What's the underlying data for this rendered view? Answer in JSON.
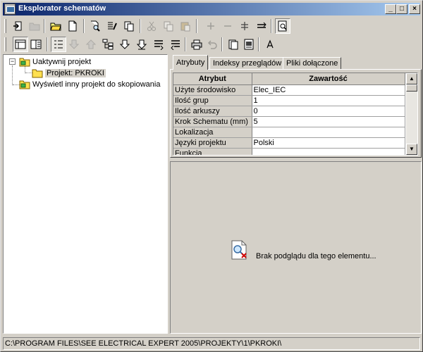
{
  "window": {
    "title": "Eksplorator schematów",
    "minimize_glyph": "_",
    "maximize_glyph": "□",
    "close_glyph": "×"
  },
  "toolbar1": [
    {
      "name": "exit-icon"
    },
    {
      "name": "open-folder-disabled-icon"
    },
    {
      "name": "open-project-icon"
    },
    {
      "name": "new-document-icon"
    },
    {
      "name": "search-icon"
    },
    {
      "name": "properties-icon"
    },
    {
      "name": "copy-project-icon"
    },
    {
      "name": "cut-icon"
    },
    {
      "name": "copy-icon"
    },
    {
      "name": "paste-icon"
    },
    {
      "name": "add-icon"
    },
    {
      "name": "remove-icon"
    },
    {
      "name": "insert-icon"
    },
    {
      "name": "replace-icon"
    },
    {
      "name": "preview-toggle-icon"
    }
  ],
  "toolbar2": [
    {
      "name": "view-details-icon"
    },
    {
      "name": "view-list-icon"
    },
    {
      "name": "sort-list-icon"
    },
    {
      "name": "move-down-icon"
    },
    {
      "name": "move-up-icon"
    },
    {
      "name": "hierarchy-icon"
    },
    {
      "name": "download-down-icon"
    },
    {
      "name": "download-alt-icon"
    },
    {
      "name": "report-icon"
    },
    {
      "name": "report-alt-icon"
    },
    {
      "name": "print-icon"
    },
    {
      "name": "undo-icon"
    },
    {
      "name": "book-icon"
    },
    {
      "name": "sheet-icon"
    },
    {
      "name": "font-icon"
    }
  ],
  "tree": {
    "root_label": "Uaktywnij projekt",
    "child_label": "Projekt: PKROKI",
    "other_label": "Wyświetl inny projekt do skopiowania"
  },
  "tabs": [
    {
      "label": "Atrybuty"
    },
    {
      "label": "Indeksy przeglądów"
    },
    {
      "label": "Pliki dołączone"
    }
  ],
  "grid": {
    "header_key": "Atrybut",
    "header_value": "Zawartość",
    "rows": [
      {
        "key": "Użyte środowisko",
        "value": "Elec_IEC"
      },
      {
        "key": "Ilość grup",
        "value": "1"
      },
      {
        "key": "Ilość arkuszy",
        "value": "0"
      },
      {
        "key": "Krok Schematu (mm)",
        "value": "5"
      },
      {
        "key": "Lokalizacja",
        "value": ""
      },
      {
        "key": "Języki projektu",
        "value": "Polski"
      },
      {
        "key": "Funkcja",
        "value": ""
      }
    ]
  },
  "preview": {
    "message": "Brak podglądu dla tego elementu..."
  },
  "status": {
    "path": "C:\\PROGRAM FILES\\SEE ELECTRICAL EXPERT 2005\\PROJEKTY\\1\\PKROKI\\"
  }
}
